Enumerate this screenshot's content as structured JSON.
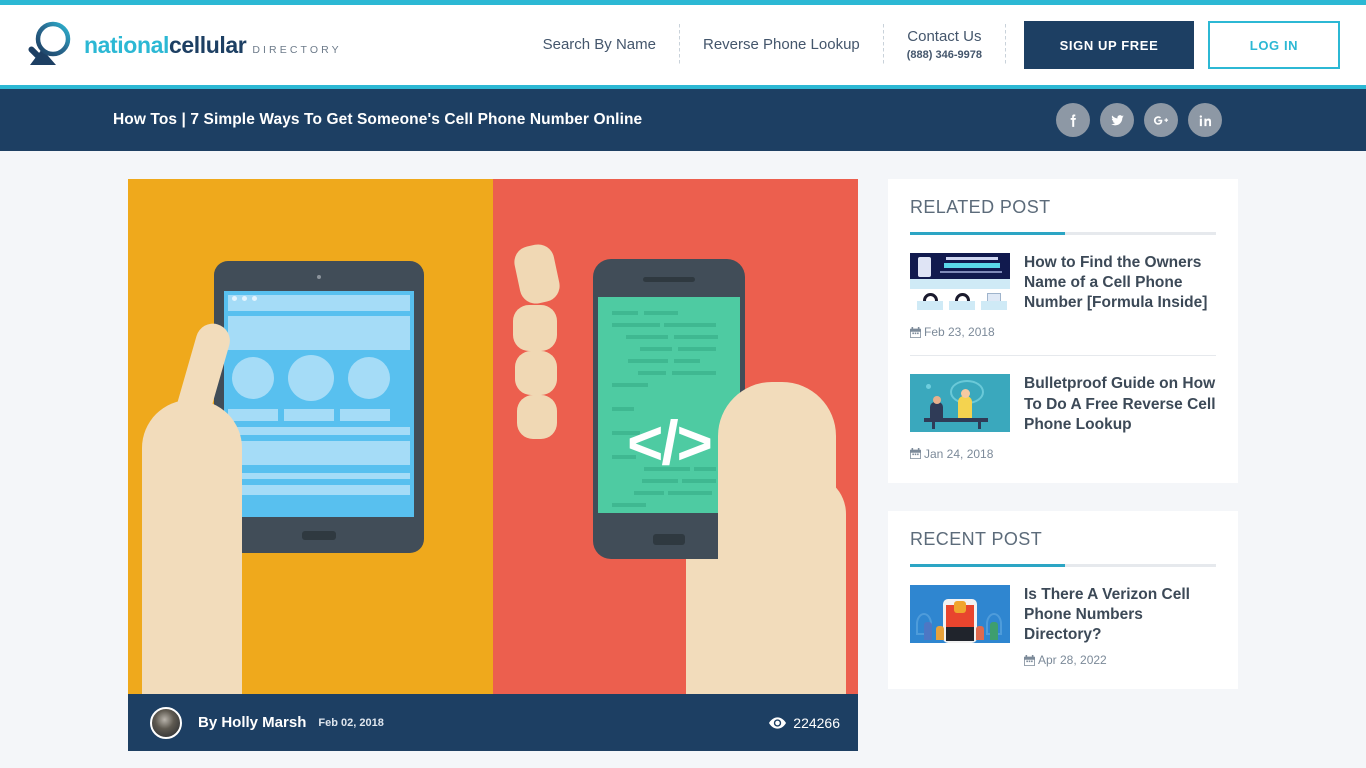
{
  "brand": {
    "logo_icon": "magnifier-icon",
    "name_part1": "national",
    "name_part2": "cellular",
    "tagline": "DIRECTORY",
    "accent_teal": "#2cb8d4",
    "accent_navy": "#1d3f63"
  },
  "header": {
    "nav": [
      {
        "label": "Search By Name"
      },
      {
        "label": "Reverse Phone Lookup"
      },
      {
        "label": "Contact Us",
        "sub": "(888) 346-9978"
      }
    ],
    "signup_label": "SIGN UP FREE",
    "login_label": "LOG IN"
  },
  "breadcrumb": {
    "title": "How Tos | 7 Simple Ways To Get Someone's Cell Phone Number Online",
    "social": [
      {
        "name": "facebook-icon",
        "glyph": "f"
      },
      {
        "name": "twitter-icon",
        "glyph": "t"
      },
      {
        "name": "google-plus-icon",
        "glyph": "G+"
      },
      {
        "name": "linkedin-icon",
        "glyph": "in"
      }
    ]
  },
  "article": {
    "hero_alt": "Hand holding tablet with wireframe on yellow, hand holding smartphone with code symbol on red",
    "code_glyph": "</>",
    "author": "By Holly Marsh",
    "date": "Feb 02, 2018",
    "views_icon": "eye-icon",
    "views": "224266"
  },
  "sidebar": {
    "related": {
      "heading": "RELATED POST",
      "posts": [
        {
          "title": "How to Find the Owners Name of a Cell Phone Number [Formula Inside]",
          "date": "Feb 23, 2018",
          "date_icon": "calendar-icon",
          "thumb": "infographic-thumbnail"
        },
        {
          "title": "Bulletproof Guide on How To Do A Free Reverse Cell Phone Lookup",
          "date": "Jan 24, 2018",
          "date_icon": "calendar-icon",
          "thumb": "desk-illustration-thumbnail"
        }
      ]
    },
    "recent": {
      "heading": "RECENT POST",
      "posts": [
        {
          "title": "Is There A Verizon Cell Phone Numbers Directory?",
          "date": "Apr 28, 2022",
          "date_icon": "calendar-icon",
          "thumb": "verizon-illustration-thumbnail"
        }
      ]
    }
  }
}
